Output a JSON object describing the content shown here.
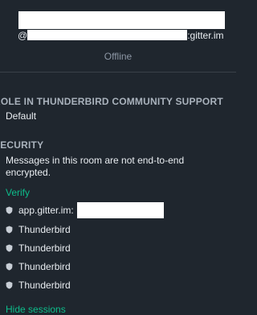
{
  "profile": {
    "mxid_prefix": "@",
    "mxid_suffix": ":gitter.im",
    "presence": "Offline"
  },
  "role": {
    "heading": "ROLE IN THUNDERBIRD COMMUNITY SUPPORT",
    "value": "Default"
  },
  "security": {
    "heading": "SECURITY",
    "message": "Messages in this room are not end-to-end encrypted.",
    "verify_label": "Verify",
    "devices": [
      {
        "name": "app.gitter.im:"
      },
      {
        "name": "Thunderbird"
      },
      {
        "name": "Thunderbird"
      },
      {
        "name": "Thunderbird"
      },
      {
        "name": "Thunderbird"
      }
    ],
    "hide_sessions_label": "Hide sessions"
  },
  "colors": {
    "background": "#1f262e",
    "accent": "#0dbd8b",
    "heading": "#a9b2bc",
    "muted": "#8d97a5"
  }
}
